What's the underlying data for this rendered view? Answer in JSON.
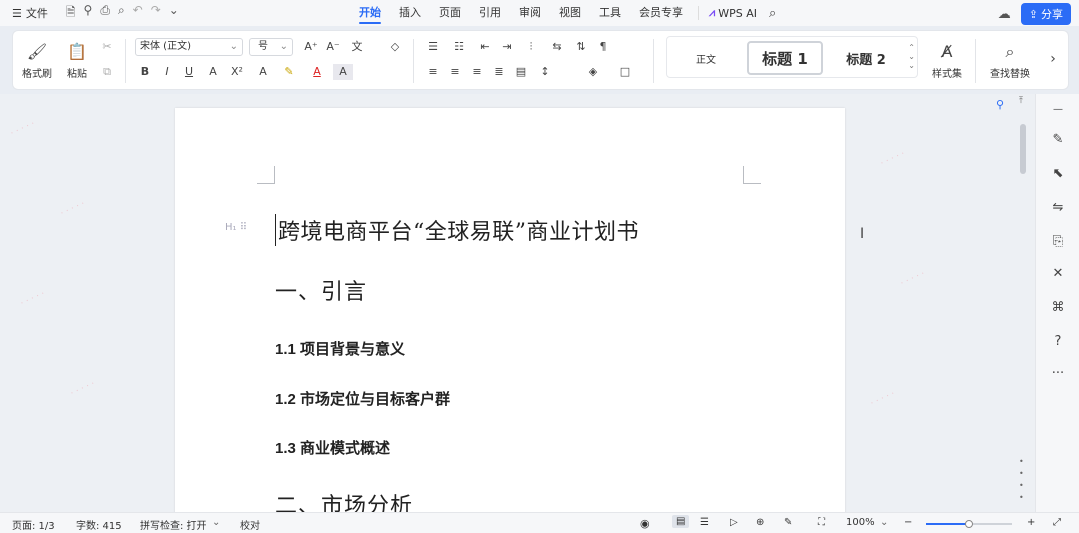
{
  "menubar": {
    "file_label": "文件",
    "tabs": [
      "开始",
      "插入",
      "页面",
      "引用",
      "审阅",
      "视图",
      "工具",
      "会员专享"
    ],
    "active_tab": "开始",
    "wps_ai": "WPS AI",
    "share": "分享"
  },
  "ribbon": {
    "format_painter": "格式刷",
    "paste": "粘贴",
    "font_name": "宋体 (正文)",
    "font_size": "号",
    "styles": {
      "normal": "正文",
      "heading1": "标题 1",
      "heading2": "标题 2"
    },
    "style_set": "样式集",
    "find_replace": "查找替换"
  },
  "document": {
    "title": "跨境电商平台“全球易联”商业计划书",
    "sections": [
      {
        "kind": "h1",
        "text": "一、引言"
      },
      {
        "kind": "h2",
        "text": "1.1 项目背景与意义"
      },
      {
        "kind": "h2",
        "text": "1.2 市场定位与目标客户群"
      },
      {
        "kind": "h2",
        "text": "1.3 商业模式概述"
      },
      {
        "kind": "h1",
        "text": "二、市场分析"
      }
    ]
  },
  "statusbar": {
    "page": "页面: 1/3",
    "words": "字数: 415",
    "spellcheck": "拼写检查: 打开",
    "proofread": "校对",
    "zoom": "100%",
    "zoom_fraction": 0.5
  }
}
